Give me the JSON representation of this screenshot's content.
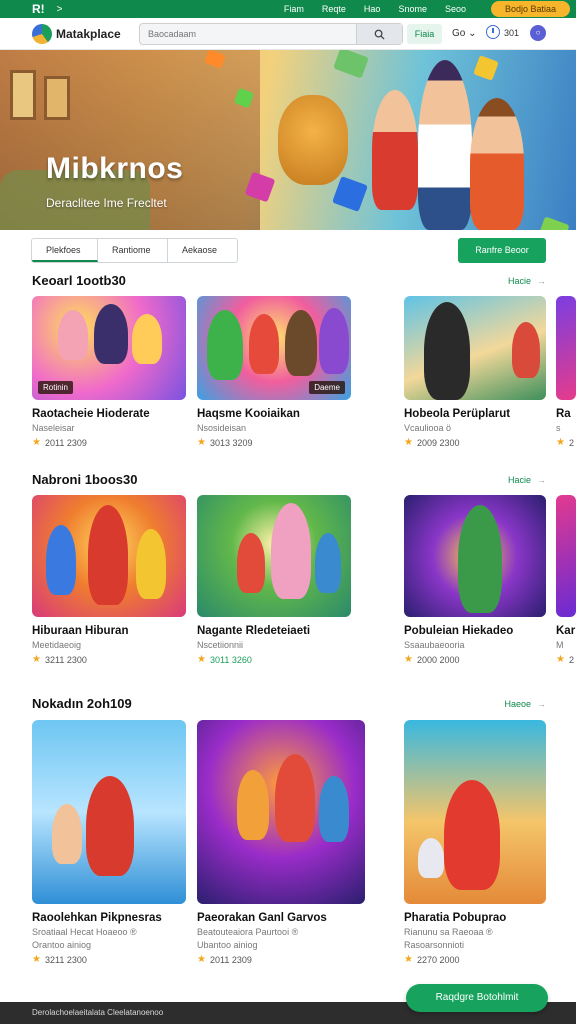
{
  "topbar": {
    "logo": "R!",
    "chevron": ">",
    "links": [
      "Fiam",
      "Reqte",
      "Hao",
      "Snome",
      "Seoo"
    ],
    "promo": "Bodjo Batiaa",
    "color": "#0f8a4c"
  },
  "header": {
    "brand": "Matakplace",
    "search_placeholder": "Baocadaam",
    "search_icon": "search-icon",
    "button": "Fiaia",
    "lang": "Go",
    "time_text": "301",
    "avatar": "○"
  },
  "hero": {
    "title": "Mibkrnos",
    "subtitle": "Deraclitee Ime Frecltet"
  },
  "tabs": [
    "Plekfoes",
    "Rantiome",
    "Aekaose"
  ],
  "cta_top": "Ranfre Beoor",
  "sections": [
    {
      "title": "Keoarl 1ootb30",
      "more": "Hacie",
      "cards": [
        {
          "title": "Raotacheie Hioderate",
          "sub": "Naseleisar",
          "rating": "2011 2309",
          "badge": "Rotinin"
        },
        {
          "title": "Haqsme Kooiaikan",
          "sub": "Nsosideisan",
          "rating": "3013 3209",
          "badge": "Daeme"
        },
        {
          "title": "Hobeola Perüplarut",
          "sub": "Vcauliooa ö",
          "rating": "2009 2300",
          "badge": ""
        },
        {
          "title": "Ra",
          "sub": "s",
          "rating": "2",
          "badge": ""
        }
      ]
    },
    {
      "title": "Nabroni 1boos30",
      "more": "Hacie",
      "cards": [
        {
          "title": "Hiburaan Hiburan",
          "sub": "Meetidaeoig",
          "rating": "3211 2300",
          "badge": ""
        },
        {
          "title": "Nagante Rledeteiaeti",
          "sub": "Nscetiionnii",
          "rating": "3011 3260",
          "badge": ""
        },
        {
          "title": "Pobuleian Hiekadeo",
          "sub": "Ssaaubaeooria",
          "rating": "2000 2000",
          "badge": ""
        },
        {
          "title": "Kar",
          "sub": "M",
          "rating": "2",
          "badge": ""
        }
      ]
    },
    {
      "title": "Nokadın 2oh109",
      "more": "Haeoe",
      "cards": [
        {
          "title": "Raoolehkan Pikpnesras",
          "sub": "Sroatiaal Hecat Hoaeoo ®",
          "sub2": "Orantoo ainiog",
          "rating": "3211 2300"
        },
        {
          "title": "Paeorakan Ganl Garvos",
          "sub": "Beatouteaiora Paurtooi ®",
          "sub2": "Ubantoo ainiog",
          "rating": "2011 2309"
        },
        {
          "title": "Pharatia Pobuprao",
          "sub": "Rianunu sa Raeoaa ®",
          "sub2": "Rasoarsonnioti",
          "rating": "2270 2000"
        }
      ]
    }
  ],
  "fab": "Raqdgre Botohlmit",
  "footer": "Derolachoelaeitalata Cleelatanoenoo"
}
